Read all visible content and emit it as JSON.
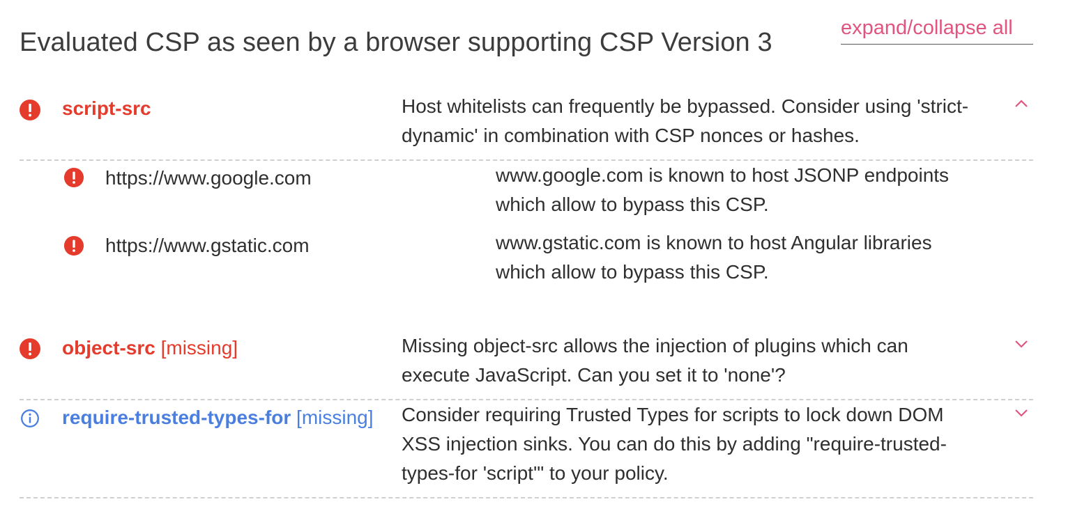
{
  "header": {
    "title": "Evaluated CSP as seen by a browser supporting CSP Version 3",
    "expand_label": "expand/collapse all"
  },
  "colors": {
    "error": "#e53b2c",
    "info": "#4a7fe0",
    "link": "#e0557f"
  },
  "findings": [
    {
      "severity": "error",
      "icon": "error-icon",
      "directive": "script-src",
      "missing_tag": "",
      "description": "Host whitelists can frequently be bypassed. Consider using 'strict-dynamic' in combination with CSP nonces or hashes.",
      "expanded": true,
      "chevron": "chevron-up-icon",
      "values": [
        {
          "icon": "error-icon",
          "host": "https://www.google.com",
          "description": "www.google.com is known to host JSONP endpoints which allow to bypass this CSP."
        },
        {
          "icon": "error-icon",
          "host": "https://www.gstatic.com",
          "description": "www.gstatic.com is known to host Angular libraries which allow to bypass this CSP."
        }
      ]
    },
    {
      "severity": "error",
      "icon": "error-icon",
      "directive": "object-src",
      "missing_tag": "[missing]",
      "description": "Missing object-src allows the injection of plugins which can execute JavaScript. Can you set it to 'none'?",
      "expanded": false,
      "chevron": "chevron-down-icon"
    },
    {
      "severity": "info",
      "icon": "info-icon",
      "directive": "require-trusted-types-for",
      "missing_tag": "[missing]",
      "description": "Consider requiring Trusted Types for scripts to lock down DOM XSS injection sinks. You can do this by adding \"require-trusted-types-for 'script'\" to your policy.",
      "expanded": false,
      "chevron": "chevron-down-icon"
    }
  ]
}
